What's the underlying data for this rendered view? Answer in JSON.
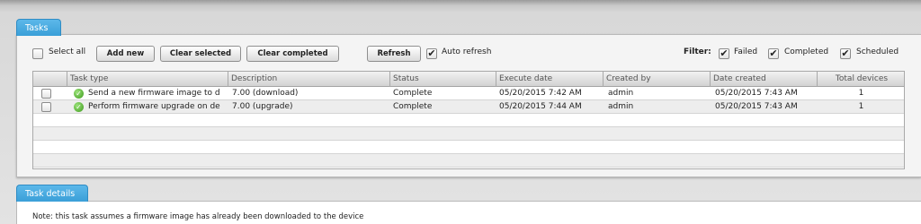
{
  "tasks_tab": {
    "label": "Tasks"
  },
  "toolbar": {
    "select_all_label": "Select all",
    "add_new": "Add new",
    "clear_selected": "Clear selected",
    "clear_completed": "Clear completed",
    "refresh": "Refresh",
    "auto_refresh_label": "Auto refresh",
    "auto_refresh_checked": true
  },
  "filter": {
    "label": "Filter:",
    "options": [
      {
        "label": "Failed",
        "checked": true
      },
      {
        "label": "Completed",
        "checked": true
      },
      {
        "label": "Scheduled",
        "checked": true
      }
    ]
  },
  "table": {
    "columns": [
      "Task type",
      "Description",
      "Status",
      "Execute date",
      "Created by",
      "Date created",
      "Total devices"
    ],
    "rows": [
      {
        "task_type": "Send a new firmware image to d",
        "description": "7.00 (download)",
        "status": "Complete",
        "execute_date": "05/20/2015 7:42 AM",
        "created_by": "admin",
        "date_created": "05/20/2015 7:43 AM",
        "total_devices": "1"
      },
      {
        "task_type": "Perform firmware upgrade on de",
        "description": "7.00 (upgrade)",
        "status": "Complete",
        "execute_date": "05/20/2015 7:44 AM",
        "created_by": "admin",
        "date_created": "05/20/2015 7:43 AM",
        "total_devices": "1"
      }
    ]
  },
  "details_tab": {
    "label": "Task details"
  },
  "details": {
    "note": "Note: this task assumes a firmware image has already been downloaded to the device"
  },
  "icons": {
    "status_complete": "check-circle-icon",
    "checkbox_checked": "checkmark-icon"
  },
  "colors": {
    "tab_blue": "#3a9fd8",
    "status_green": "#3e9a1e"
  }
}
